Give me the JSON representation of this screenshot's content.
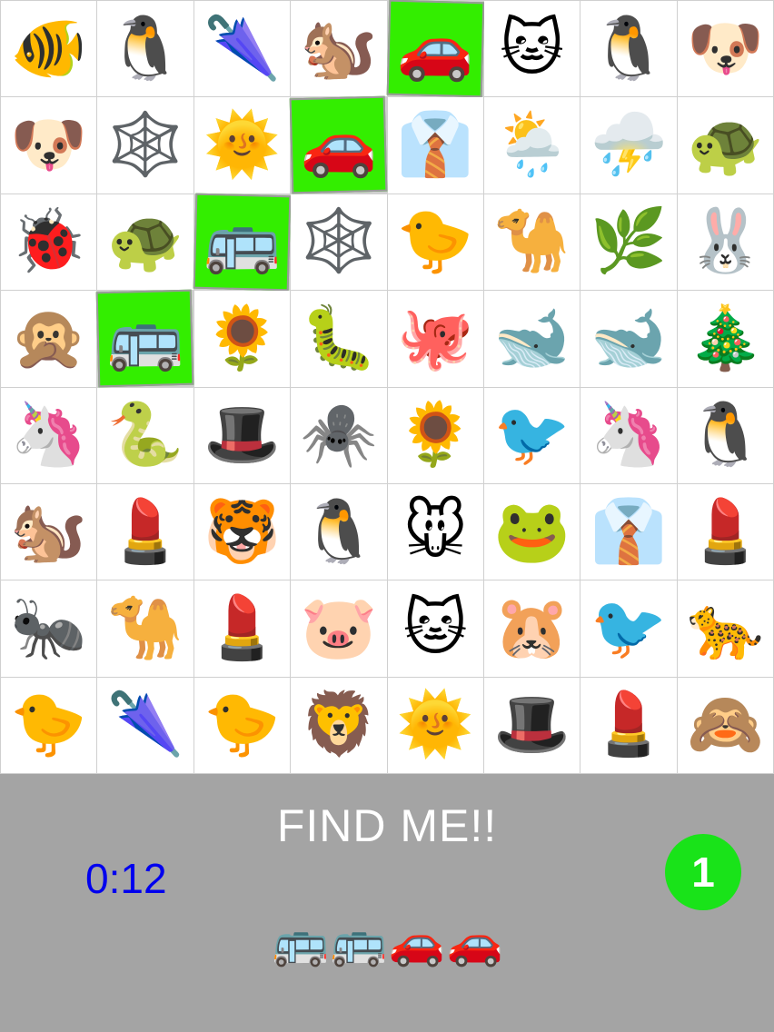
{
  "colors": {
    "highlight": "#33ee00",
    "panel": "#a4a4a4",
    "timer": "#0000ee",
    "badge": "#19e319"
  },
  "grid": [
    [
      {
        "icon": "tropical-fish-icon",
        "glyph": "🐠"
      },
      {
        "icon": "penguin-icon",
        "glyph": "🐧"
      },
      {
        "icon": "closed-umbrella-icon",
        "glyph": "🌂"
      },
      {
        "icon": "chipmunk-icon",
        "glyph": "🐿️"
      },
      {
        "icon": "red-car-icon",
        "glyph": "🚗",
        "found": true
      },
      {
        "icon": "cat-face-icon",
        "glyph": "🐱"
      },
      {
        "icon": "penguin-icon",
        "glyph": "🐧"
      },
      {
        "icon": "dog-face-icon",
        "glyph": "🐶"
      }
    ],
    [
      {
        "icon": "dog-face-icon",
        "glyph": "🐶"
      },
      {
        "icon": "spider-web-icon",
        "glyph": "🕸️"
      },
      {
        "icon": "sun-face-icon",
        "glyph": "🌞"
      },
      {
        "icon": "red-car-icon",
        "glyph": "🚗",
        "found": true
      },
      {
        "icon": "shirt-tie-icon",
        "glyph": "👔"
      },
      {
        "icon": "sun-rain-cloud-icon",
        "glyph": "🌦️"
      },
      {
        "icon": "thunder-cloud-icon",
        "glyph": "⛈️"
      },
      {
        "icon": "turtle-icon",
        "glyph": "🐢"
      }
    ],
    [
      {
        "icon": "ladybug-icon",
        "glyph": "🐞"
      },
      {
        "icon": "turtle-icon",
        "glyph": "🐢"
      },
      {
        "icon": "bus-icon",
        "glyph": "🚌",
        "found": true
      },
      {
        "icon": "spider-web-icon",
        "glyph": "🕸️"
      },
      {
        "icon": "chick-icon",
        "glyph": "🐤"
      },
      {
        "icon": "camel-icon",
        "glyph": "🐪"
      },
      {
        "icon": "herb-icon",
        "glyph": "🌿"
      },
      {
        "icon": "rabbit-face-icon",
        "glyph": "🐰"
      }
    ],
    [
      {
        "icon": "speak-no-evil-monkey-icon",
        "glyph": "🙊"
      },
      {
        "icon": "bus-icon",
        "glyph": "🚌",
        "found": true
      },
      {
        "icon": "sunflower-icon",
        "glyph": "🌻"
      },
      {
        "icon": "caterpillar-icon",
        "glyph": "🐛"
      },
      {
        "icon": "octopus-icon",
        "glyph": "🐙"
      },
      {
        "icon": "whale-icon",
        "glyph": "🐋"
      },
      {
        "icon": "whale-icon",
        "glyph": "🐋"
      },
      {
        "icon": "christmas-tree-icon",
        "glyph": "🎄"
      }
    ],
    [
      {
        "icon": "unicorn-icon",
        "glyph": "🦄"
      },
      {
        "icon": "snake-icon",
        "glyph": "🐍"
      },
      {
        "icon": "top-hat-icon",
        "glyph": "🎩"
      },
      {
        "icon": "spider-icon",
        "glyph": "🕷️"
      },
      {
        "icon": "sunflower-icon",
        "glyph": "🌻"
      },
      {
        "icon": "bird-head-icon",
        "glyph": "🐦"
      },
      {
        "icon": "unicorn-icon",
        "glyph": "🦄"
      },
      {
        "icon": "penguin-icon",
        "glyph": "🐧"
      }
    ],
    [
      {
        "icon": "chipmunk-icon",
        "glyph": "🐿️"
      },
      {
        "icon": "lipstick-icon",
        "glyph": "💄"
      },
      {
        "icon": "tiger-face-icon",
        "glyph": "🐯"
      },
      {
        "icon": "penguin-icon",
        "glyph": "🐧"
      },
      {
        "icon": "mouse-face-icon",
        "glyph": "🐭"
      },
      {
        "icon": "frog-icon",
        "glyph": "🐸"
      },
      {
        "icon": "shirt-tie-icon",
        "glyph": "👔"
      },
      {
        "icon": "lipstick-icon",
        "glyph": "💄"
      }
    ],
    [
      {
        "icon": "ant-icon",
        "glyph": "🐜"
      },
      {
        "icon": "camel-icon",
        "glyph": "🐪"
      },
      {
        "icon": "lipstick-icon",
        "glyph": "💄"
      },
      {
        "icon": "pig-face-icon",
        "glyph": "🐷"
      },
      {
        "icon": "cat-face-icon",
        "glyph": "🐱"
      },
      {
        "icon": "hamster-icon",
        "glyph": "🐹"
      },
      {
        "icon": "bird-head-icon",
        "glyph": "🐦"
      },
      {
        "icon": "leopard-icon",
        "glyph": "🐆"
      }
    ],
    [
      {
        "icon": "chick-icon",
        "glyph": "🐤"
      },
      {
        "icon": "closed-umbrella-icon",
        "glyph": "🌂"
      },
      {
        "icon": "chick-icon",
        "glyph": "🐤"
      },
      {
        "icon": "lion-face-icon",
        "glyph": "🦁"
      },
      {
        "icon": "sun-face-icon",
        "glyph": "🌞"
      },
      {
        "icon": "top-hat-icon",
        "glyph": "🎩"
      },
      {
        "icon": "lipstick-icon",
        "glyph": "💄"
      },
      {
        "icon": "see-no-evil-monkey-icon",
        "glyph": "🙈"
      }
    ]
  ],
  "panel": {
    "title": "FIND ME!!",
    "timer": "0:12",
    "score": "1",
    "targets": [
      {
        "icon": "bus-icon",
        "glyph": "🚌"
      },
      {
        "icon": "bus-icon",
        "glyph": "🚌"
      },
      {
        "icon": "red-car-icon",
        "glyph": "🚗"
      },
      {
        "icon": "red-car-icon",
        "glyph": "🚗"
      }
    ]
  }
}
